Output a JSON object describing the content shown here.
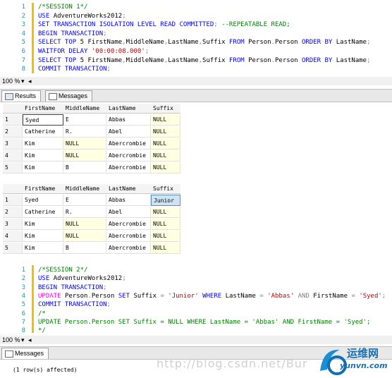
{
  "session1": {
    "lines": [
      {
        "num": "1",
        "parts": [
          {
            "t": "/*SESSION 1*/",
            "c": "cm"
          }
        ]
      },
      {
        "num": "2",
        "parts": [
          {
            "t": "USE ",
            "c": "kw"
          },
          {
            "t": "AdventureWorks2012",
            "c": ""
          },
          {
            "t": ";",
            "c": "gray"
          }
        ]
      },
      {
        "num": "3",
        "parts": [
          {
            "t": "SET TRANSACTION ISOLATION LEVEL READ COMMITTED",
            "c": "kw"
          },
          {
            "t": "; ",
            "c": "gray"
          },
          {
            "t": "--REPEATABLE READ;",
            "c": "cm"
          }
        ]
      },
      {
        "num": "4",
        "parts": [
          {
            "t": "BEGIN TRANSACTION",
            "c": "kw"
          },
          {
            "t": ";",
            "c": "gray"
          }
        ]
      },
      {
        "num": "5",
        "parts": [
          {
            "t": "SELECT TOP ",
            "c": "kw"
          },
          {
            "t": "5 ",
            "c": ""
          },
          {
            "t": "FirstName",
            "c": ""
          },
          {
            "t": ",",
            "c": "gray"
          },
          {
            "t": "MiddleName",
            "c": ""
          },
          {
            "t": ",",
            "c": "gray"
          },
          {
            "t": "LastName",
            "c": ""
          },
          {
            "t": ",",
            "c": "gray"
          },
          {
            "t": "Suffix ",
            "c": ""
          },
          {
            "t": "FROM ",
            "c": "kw"
          },
          {
            "t": "Person",
            "c": ""
          },
          {
            "t": ".",
            "c": "gray"
          },
          {
            "t": "Person ",
            "c": ""
          },
          {
            "t": "ORDER BY ",
            "c": "kw"
          },
          {
            "t": "LastName",
            "c": ""
          },
          {
            "t": ";",
            "c": "gray"
          }
        ]
      },
      {
        "num": "6",
        "parts": [
          {
            "t": "WAITFOR DELAY ",
            "c": "kw"
          },
          {
            "t": "'00:00:08.000'",
            "c": "str"
          },
          {
            "t": ";",
            "c": "gray"
          }
        ]
      },
      {
        "num": "7",
        "parts": [
          {
            "t": "SELECT TOP ",
            "c": "kw"
          },
          {
            "t": "5 ",
            "c": ""
          },
          {
            "t": "FirstName",
            "c": ""
          },
          {
            "t": ",",
            "c": "gray"
          },
          {
            "t": "MiddleName",
            "c": ""
          },
          {
            "t": ",",
            "c": "gray"
          },
          {
            "t": "LastName",
            "c": ""
          },
          {
            "t": ",",
            "c": "gray"
          },
          {
            "t": "Suffix ",
            "c": ""
          },
          {
            "t": "FROM ",
            "c": "kw"
          },
          {
            "t": "Person",
            "c": ""
          },
          {
            "t": ".",
            "c": "gray"
          },
          {
            "t": "Person ",
            "c": ""
          },
          {
            "t": "ORDER BY ",
            "c": "kw"
          },
          {
            "t": "LastName",
            "c": ""
          },
          {
            "t": ";",
            "c": "gray"
          }
        ]
      },
      {
        "num": "8",
        "parts": [
          {
            "t": "COMMIT TRANSACTION",
            "c": "kw"
          },
          {
            "t": ";",
            "c": "gray"
          }
        ]
      }
    ]
  },
  "zoom1": "100 %",
  "tabs1": {
    "results": "Results",
    "messages": "Messages"
  },
  "grid_headers": [
    "FirstName",
    "MiddleName",
    "LastName",
    "Suffix"
  ],
  "grid1": [
    {
      "n": "1",
      "cells": [
        "Syed",
        "E",
        "Abbas",
        "NULL"
      ]
    },
    {
      "n": "2",
      "cells": [
        "Catherine",
        "R.",
        "Abel",
        "NULL"
      ]
    },
    {
      "n": "3",
      "cells": [
        "Kim",
        "NULL",
        "Abercrombie",
        "NULL"
      ]
    },
    {
      "n": "4",
      "cells": [
        "Kim",
        "NULL",
        "Abercrombie",
        "NULL"
      ]
    },
    {
      "n": "5",
      "cells": [
        "Kim",
        "B",
        "Abercrombie",
        "NULL"
      ]
    }
  ],
  "grid2": [
    {
      "n": "1",
      "cells": [
        "Syed",
        "E",
        "Abbas",
        "Junior"
      ]
    },
    {
      "n": "2",
      "cells": [
        "Catherine",
        "R.",
        "Abel",
        "NULL"
      ]
    },
    {
      "n": "3",
      "cells": [
        "Kim",
        "NULL",
        "Abercrombie",
        "NULL"
      ]
    },
    {
      "n": "4",
      "cells": [
        "Kim",
        "NULL",
        "Abercrombie",
        "NULL"
      ]
    },
    {
      "n": "5",
      "cells": [
        "Kim",
        "B",
        "Abercrombie",
        "NULL"
      ]
    }
  ],
  "session2": {
    "lines": [
      {
        "num": "1",
        "parts": [
          {
            "t": "/*SESSION 2*/",
            "c": "cm"
          }
        ]
      },
      {
        "num": "2",
        "parts": [
          {
            "t": "USE ",
            "c": "kw"
          },
          {
            "t": "AdventureWorks2012",
            "c": ""
          },
          {
            "t": ";",
            "c": "gray"
          }
        ]
      },
      {
        "num": "3",
        "parts": [
          {
            "t": "BEGIN TRANSACTION",
            "c": "kw"
          },
          {
            "t": ";",
            "c": "gray"
          }
        ]
      },
      {
        "num": "4",
        "parts": [
          {
            "t": "UPDATE ",
            "c": "pink"
          },
          {
            "t": "Person",
            "c": ""
          },
          {
            "t": ".",
            "c": "gray"
          },
          {
            "t": "Person ",
            "c": ""
          },
          {
            "t": "SET ",
            "c": "kw"
          },
          {
            "t": "Suffix ",
            "c": ""
          },
          {
            "t": "= ",
            "c": "gray"
          },
          {
            "t": "'Junior' ",
            "c": "str"
          },
          {
            "t": "WHERE ",
            "c": "kw"
          },
          {
            "t": "LastName ",
            "c": ""
          },
          {
            "t": "= ",
            "c": "gray"
          },
          {
            "t": "'Abbas' ",
            "c": "str"
          },
          {
            "t": "AND ",
            "c": "gray"
          },
          {
            "t": "FirstName ",
            "c": ""
          },
          {
            "t": "= ",
            "c": "gray"
          },
          {
            "t": "'Syed'",
            "c": "str"
          },
          {
            "t": ";",
            "c": "gray"
          }
        ]
      },
      {
        "num": "5",
        "parts": [
          {
            "t": "COMMIT TRANSACTION",
            "c": "kw"
          },
          {
            "t": ";",
            "c": "gray"
          }
        ]
      },
      {
        "num": "6",
        "parts": [
          {
            "t": "/*",
            "c": "cm"
          }
        ]
      },
      {
        "num": "7",
        "parts": [
          {
            "t": "UPDATE Person.Person SET Suffix = NULL WHERE LastName = 'Abbas' AND FirstName = 'Syed';",
            "c": "cm"
          }
        ]
      },
      {
        "num": "8",
        "parts": [
          {
            "t": "*/",
            "c": "cm"
          }
        ]
      }
    ]
  },
  "zoom2": "100 %",
  "tabs2": {
    "messages": "Messages"
  },
  "message": "(1 row(s) affected)",
  "watermark": "http://blog.csdn.net/Bur",
  "logo": {
    "text": "运维网",
    "sub": "yunvn.com"
  }
}
